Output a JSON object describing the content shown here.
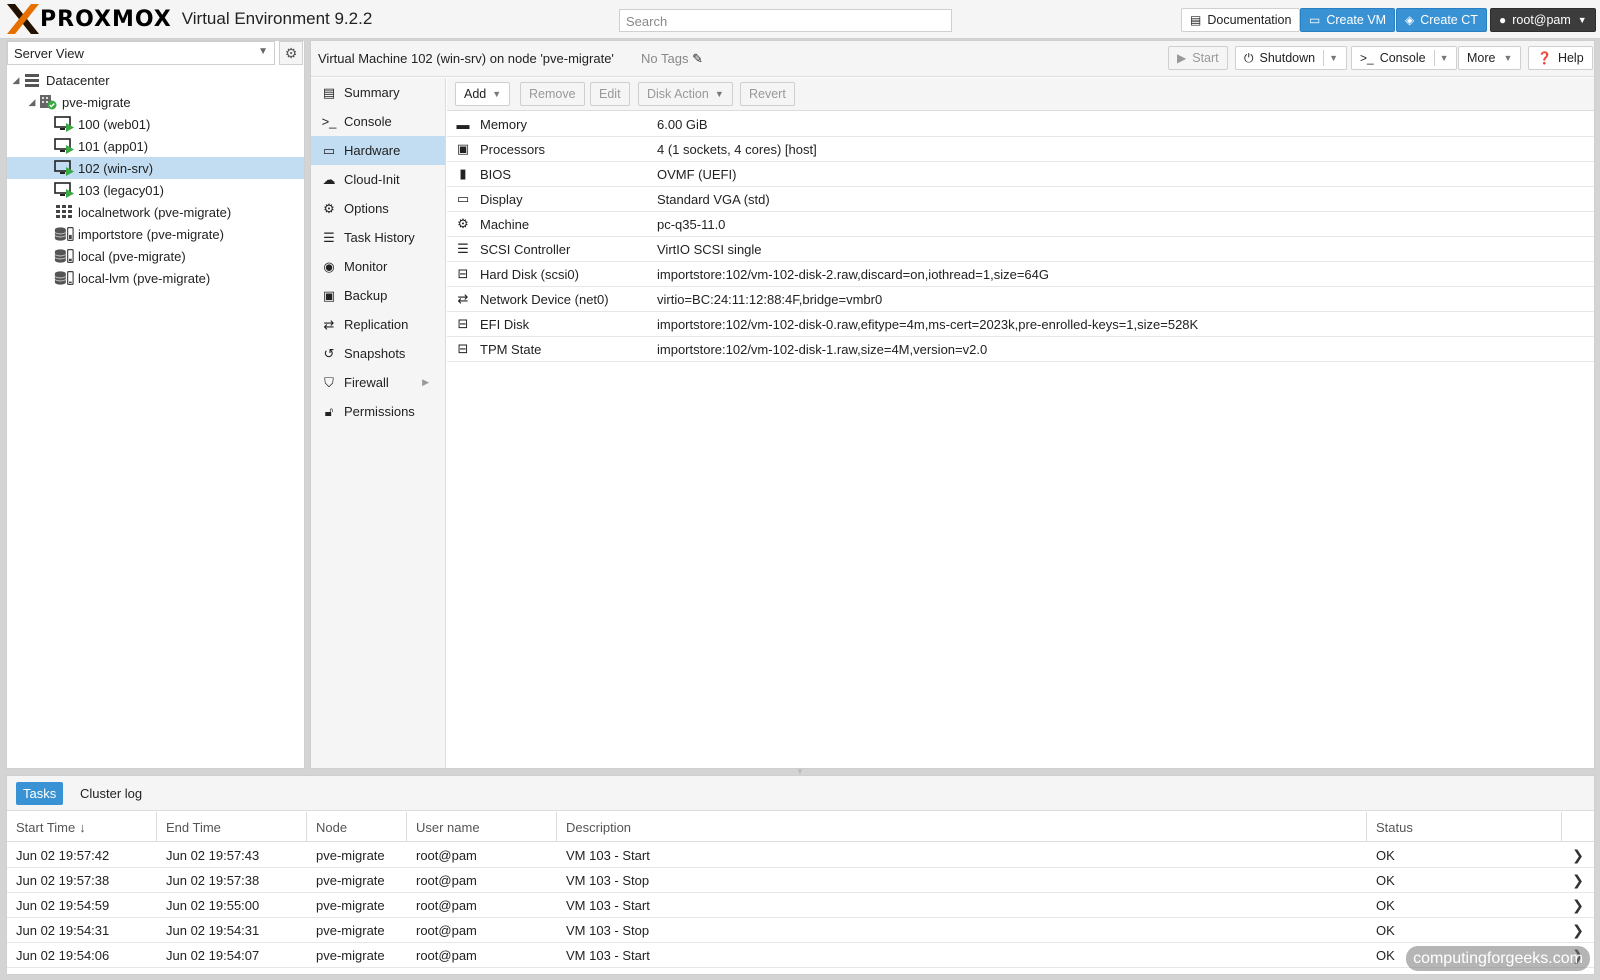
{
  "header": {
    "brand": "PROXMOX",
    "product": "Virtual Environment 9.2.2",
    "search_placeholder": "Search",
    "documentation": "Documentation",
    "create_vm": "Create VM",
    "create_ct": "Create CT",
    "user": "root@pam"
  },
  "left": {
    "view": "Server View",
    "tree": [
      {
        "label": "Datacenter",
        "icon": "datacenter-icon"
      },
      {
        "label": "pve-migrate",
        "icon": "node-icon"
      },
      {
        "label": "100 (web01)",
        "icon": "vm-running-icon"
      },
      {
        "label": "101 (app01)",
        "icon": "vm-running-icon"
      },
      {
        "label": "102 (win-srv)",
        "icon": "vm-running-icon"
      },
      {
        "label": "103 (legacy01)",
        "icon": "vm-running-icon"
      },
      {
        "label": "localnetwork (pve-migrate)",
        "icon": "network-icon"
      },
      {
        "label": "importstore (pve-migrate)",
        "icon": "storage-icon"
      },
      {
        "label": "local (pve-migrate)",
        "icon": "storage-icon"
      },
      {
        "label": "local-lvm (pve-migrate)",
        "icon": "storage-icon"
      }
    ]
  },
  "main": {
    "title": "Virtual Machine 102 (win-srv) on node 'pve-migrate'",
    "tags": "No Tags",
    "buttons": {
      "start": "Start",
      "shutdown": "Shutdown",
      "console": "Console",
      "more": "More",
      "help": "Help"
    },
    "nav": [
      {
        "label": "Summary",
        "icon": "summary-icon"
      },
      {
        "label": "Console",
        "icon": "console-icon"
      },
      {
        "label": "Hardware",
        "icon": "hardware-icon"
      },
      {
        "label": "Cloud-Init",
        "icon": "cloud-icon"
      },
      {
        "label": "Options",
        "icon": "gear-icon"
      },
      {
        "label": "Task History",
        "icon": "list-icon"
      },
      {
        "label": "Monitor",
        "icon": "eye-icon"
      },
      {
        "label": "Backup",
        "icon": "floppy-icon"
      },
      {
        "label": "Replication",
        "icon": "retweet-icon"
      },
      {
        "label": "Snapshots",
        "icon": "history-icon"
      },
      {
        "label": "Firewall",
        "icon": "shield-icon"
      },
      {
        "label": "Permissions",
        "icon": "unlock-icon"
      }
    ],
    "hw_toolbar": {
      "add": "Add",
      "remove": "Remove",
      "edit": "Edit",
      "disk_action": "Disk Action",
      "revert": "Revert"
    },
    "hardware": [
      {
        "key": "Memory",
        "value": "6.00 GiB",
        "icon": "memory-icon"
      },
      {
        "key": "Processors",
        "value": "4 (1 sockets, 4 cores) [host]",
        "icon": "cpu-icon"
      },
      {
        "key": "BIOS",
        "value": "OVMF (UEFI)",
        "icon": "microchip-icon"
      },
      {
        "key": "Display",
        "value": "Standard VGA (std)",
        "icon": "desktop-icon"
      },
      {
        "key": "Machine",
        "value": "pc-q35-11.0",
        "icon": "cogs-icon"
      },
      {
        "key": "SCSI Controller",
        "value": "VirtIO SCSI single",
        "icon": "database-icon"
      },
      {
        "key": "Hard Disk (scsi0)",
        "value": "importstore:102/vm-102-disk-2.raw,discard=on,iothread=1,size=64G",
        "icon": "hdd-icon"
      },
      {
        "key": "Network Device (net0)",
        "value": "virtio=BC:24:11:12:88:4F,bridge=vmbr0",
        "icon": "exchange-icon"
      },
      {
        "key": "EFI Disk",
        "value": "importstore:102/vm-102-disk-0.raw,efitype=4m,ms-cert=2023k,pre-enrolled-keys=1,size=528K",
        "icon": "hdd-icon"
      },
      {
        "key": "TPM State",
        "value": "importstore:102/vm-102-disk-1.raw,size=4M,version=v2.0",
        "icon": "hdd-icon"
      }
    ]
  },
  "tasks": {
    "tabs": [
      "Tasks",
      "Cluster log"
    ],
    "columns": [
      "Start Time",
      "End Time",
      "Node",
      "User name",
      "Description",
      "Status"
    ],
    "rows": [
      [
        "Jun 02 19:57:42",
        "Jun 02 19:57:43",
        "pve-migrate",
        "root@pam",
        "VM 103 - Start",
        "OK"
      ],
      [
        "Jun 02 19:57:38",
        "Jun 02 19:57:38",
        "pve-migrate",
        "root@pam",
        "VM 103 - Stop",
        "OK"
      ],
      [
        "Jun 02 19:54:59",
        "Jun 02 19:55:00",
        "pve-migrate",
        "root@pam",
        "VM 103 - Start",
        "OK"
      ],
      [
        "Jun 02 19:54:31",
        "Jun 02 19:54:31",
        "pve-migrate",
        "root@pam",
        "VM 103 - Stop",
        "OK"
      ],
      [
        "Jun 02 19:54:06",
        "Jun 02 19:54:07",
        "pve-migrate",
        "root@pam",
        "VM 103 - Start",
        "OK"
      ]
    ]
  },
  "watermark": "computingforgeeks.com",
  "colors": {
    "accent": "#3892d4",
    "selection": "#c2ddf2",
    "brand_orange": "#e57000"
  }
}
